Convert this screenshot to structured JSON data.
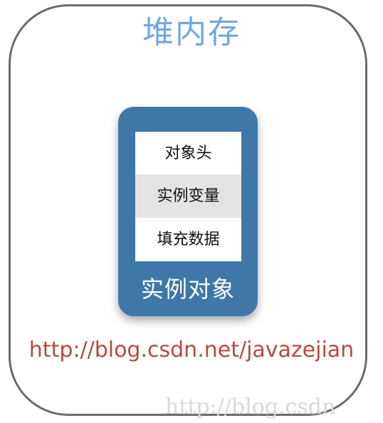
{
  "heap": {
    "title": "堆内存"
  },
  "instance": {
    "rows": [
      {
        "label": "对象头"
      },
      {
        "label": "实例变量"
      },
      {
        "label": "填充数据"
      }
    ],
    "label": "实例对象"
  },
  "url_text": "http://blog.csdn.net/javazejian",
  "watermark": "http://blog.csdn",
  "colors": {
    "heap_title": "#6fa6e6",
    "instance_fill": "#3e77a8",
    "highlight_row": "#e3e3e3",
    "url": "#b84a3c"
  }
}
